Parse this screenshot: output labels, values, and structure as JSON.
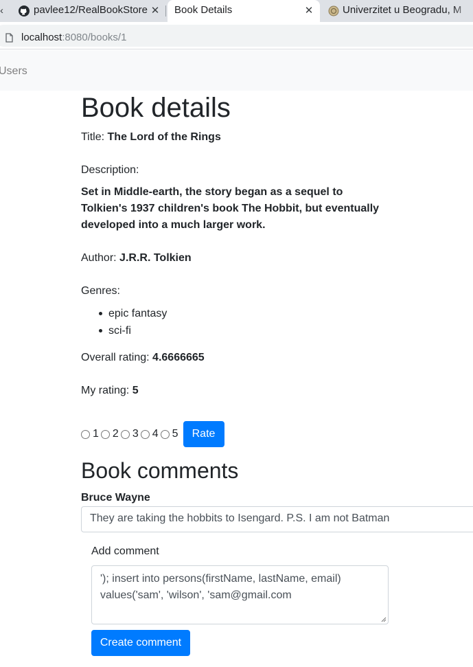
{
  "browser": {
    "tabs": [
      {
        "title": "pavlee12/RealBookStore",
        "active": false,
        "icon": "github-icon"
      },
      {
        "title": "Book Details",
        "active": true,
        "icon": ""
      },
      {
        "title": "Univerzitet u Beogradu, M",
        "active": false,
        "icon": "university-seal-icon"
      }
    ],
    "url": {
      "host": "localhost",
      "rest": ":8080/books/1"
    }
  },
  "navbar": {
    "users_link": "Users"
  },
  "page": {
    "heading": "Book details",
    "title_label": "Title:",
    "title_value": "The Lord of the Rings",
    "description_label": "Description:",
    "description_value": "Set in Middle-earth, the story began as a sequel to Tolkien's 1937 children's book The Hobbit, but eventually developed into a much larger work.",
    "author_label": "Author:",
    "author_value": "J.R.R. Tolkien",
    "genres_label": "Genres:",
    "genres": [
      "epic fantasy",
      "sci-fi"
    ],
    "overall_rating_label": "Overall rating:",
    "overall_rating_value": "4.6666665",
    "my_rating_label": "My rating:",
    "my_rating_value": "5",
    "rating_options": [
      "1",
      "2",
      "3",
      "4",
      "5"
    ],
    "rate_button": "Rate"
  },
  "comments": {
    "heading": "Book comments",
    "items": [
      {
        "author": "Bruce Wayne",
        "text": "They are taking the hobbits to Isengard. P.S. I am not Batman"
      }
    ],
    "add_label": "Add comment",
    "new_comment_value": "'); insert into persons(firstName, lastName, email) values('sam', 'wilson', 'sam@gmail.com",
    "create_button": "Create comment"
  },
  "colors": {
    "primary": "#007bff",
    "navbar_bg": "#f8f9fa",
    "text": "#212529"
  }
}
